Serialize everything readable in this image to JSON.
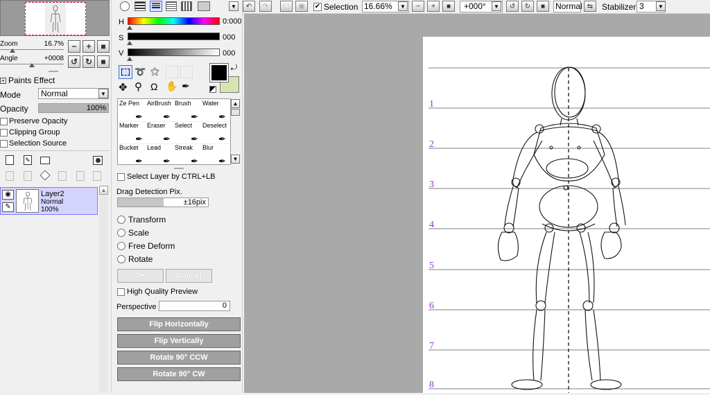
{
  "navigator": {
    "zoom_label": "Zoom",
    "zoom_value": "16.7%",
    "angle_label": "Angle",
    "angle_value": "+0008"
  },
  "layer_props": {
    "paints_effect": "Paints Effect",
    "mode_label": "Mode",
    "mode_value": "Normal",
    "opacity_label": "Opacity",
    "opacity_value": "100%",
    "opacity_fraction": 1.0,
    "preserve_opacity": "Preserve Opacity",
    "clipping_group": "Clipping Group",
    "selection_source": "Selection Source"
  },
  "layer": {
    "name": "Layer2",
    "mode": "Normal",
    "opacity": "100%"
  },
  "color": {
    "h_label": "H",
    "h_value": "0:000",
    "s_label": "S",
    "s_value": "000",
    "v_label": "V",
    "v_value": "000",
    "fg": "#000000",
    "bg": "#d8e4b0"
  },
  "tools": [
    {
      "label": "Ze Pen"
    },
    {
      "label": "AirBrush"
    },
    {
      "label": "Brush"
    },
    {
      "label": "Water"
    },
    {
      "label": "Marker"
    },
    {
      "label": "Eraser"
    },
    {
      "label": "Select"
    },
    {
      "label": "Deselect"
    },
    {
      "label": "Bucket"
    },
    {
      "label": "Lead"
    },
    {
      "label": "Streak"
    },
    {
      "label": "Blur"
    }
  ],
  "transform": {
    "select_layer": "Select Layer by CTRL+LB",
    "drag_detection": "Drag Detection Pix.",
    "drag_value": "±16pix",
    "options": [
      "Transform",
      "Scale",
      "Free Deform",
      "Rotate"
    ],
    "ok": "OK",
    "cancel": "Cancel",
    "hq_preview": "High Quality Preview",
    "perspective_label": "Perspective",
    "perspective_value": "0",
    "flip_h": "Flip Horizontally",
    "flip_v": "Flip Vertically",
    "rot_ccw": "Rotate 90° CCW",
    "rot_cw": "Rotate 90° CW"
  },
  "toolbar": {
    "selection_label": "Selection",
    "zoom_value": "16.66%",
    "angle_value": "+000°",
    "blend_value": "Normal",
    "stabilizer_label": "Stabilizer",
    "stabilizer_value": "3"
  },
  "canvas": {
    "guide_numbers": [
      "1",
      "2",
      "3",
      "4",
      "5",
      "6",
      "7",
      "8"
    ],
    "guide_color": "#9933cc"
  }
}
